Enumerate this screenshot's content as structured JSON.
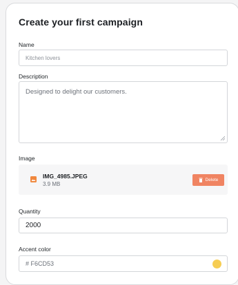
{
  "form": {
    "title": "Create your first campaign",
    "name": {
      "label": "Name",
      "value": "Kitchen lovers"
    },
    "description": {
      "label": "Description",
      "value": "Designed to delight our customers."
    },
    "image": {
      "label": "Image",
      "file_name": "IMG_4985.JPEG",
      "file_size": "3.9 MB",
      "delete_label": "Delete",
      "icon": "image-file-icon"
    },
    "quantity": {
      "label": "Quantity",
      "value": "2000"
    },
    "accent_color": {
      "label": "Accent color",
      "value": "# F6CD53",
      "swatch_color": "#F6CD53"
    }
  },
  "colors": {
    "delete_button": "#F08462",
    "file_icon": "#F0883E"
  }
}
